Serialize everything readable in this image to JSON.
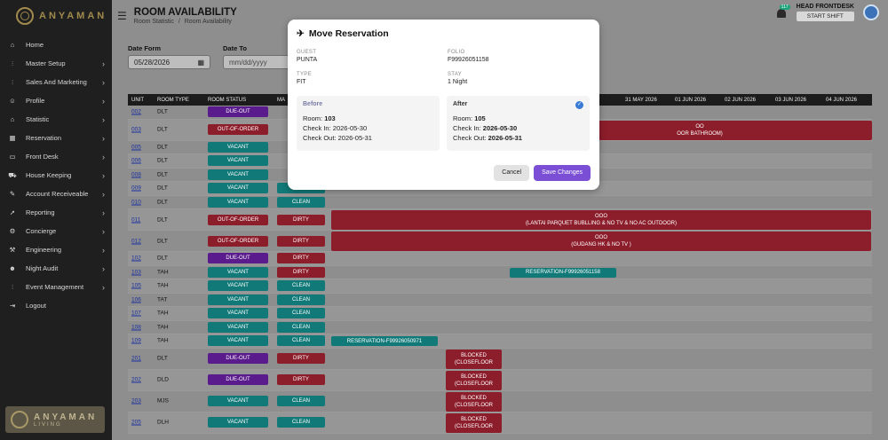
{
  "brand": {
    "name": "ANYAMAN",
    "badge_name": "ANYAMAN",
    "badge_sub": "LIVING"
  },
  "sidebar": {
    "items": [
      {
        "label": "Home",
        "icon": "home-icon",
        "chevron": false
      },
      {
        "label": "Master Setup",
        "icon": "sliders-icon",
        "chevron": true
      },
      {
        "label": "Sales And Marketing",
        "icon": "sliders-icon",
        "chevron": true
      },
      {
        "label": "Profile",
        "icon": "profile-icon",
        "chevron": true
      },
      {
        "label": "Statistic",
        "icon": "house-icon",
        "chevron": true
      },
      {
        "label": "Reservation",
        "icon": "calendar-icon",
        "chevron": true
      },
      {
        "label": "Front Desk",
        "icon": "monitor-icon",
        "chevron": true
      },
      {
        "label": "House Keeping",
        "icon": "cart-icon",
        "chevron": true
      },
      {
        "label": "Account Receiveable",
        "icon": "tag-icon",
        "chevron": true
      },
      {
        "label": "Reporting",
        "icon": "rocket-icon",
        "chevron": true
      },
      {
        "label": "Concierge",
        "icon": "gear-icon",
        "chevron": true
      },
      {
        "label": "Engineering",
        "icon": "wrench-icon",
        "chevron": true
      },
      {
        "label": "Night Audit",
        "icon": "users-icon",
        "chevron": true
      },
      {
        "label": "Event Management",
        "icon": "sliders-icon",
        "chevron": true
      },
      {
        "label": "Logout",
        "icon": "logout-icon",
        "chevron": false
      }
    ]
  },
  "header": {
    "title": "ROOM AVAILABILITY",
    "breadcrumb": [
      "Room Statistic",
      "/",
      "Room Availability"
    ],
    "notif_count": "117",
    "user_name": "HEAD FRONTDESK",
    "shift_label": "START SHIFT"
  },
  "filters": {
    "date_from_label": "Date Form",
    "date_from_value": "05/28/2026",
    "date_to_label": "Date To",
    "date_to_placeholder": "mm/dd/yyyy"
  },
  "grid": {
    "headers": [
      "UNIT",
      "ROOM TYPE",
      "ROOM STATUS",
      "MA",
      "31 MAY 2026",
      "01 JUN 2026",
      "02 JUN 2026",
      "03 JUN 2026",
      "04 JUN 2026"
    ],
    "rows": [
      {
        "unit": "002",
        "type": "DLT",
        "status": "DUE-OUT",
        "maid": ""
      },
      {
        "unit": "003",
        "type": "DLT",
        "status": "OUT-OF-ORDER",
        "maid": ""
      },
      {
        "unit": "005",
        "type": "DLT",
        "status": "VACANT",
        "maid": ""
      },
      {
        "unit": "006",
        "type": "DLT",
        "status": "VACANT",
        "maid": ""
      },
      {
        "unit": "008",
        "type": "DLT",
        "status": "VACANT",
        "maid": ""
      },
      {
        "unit": "009",
        "type": "DLT",
        "status": "VACANT",
        "maid": "CLEAN"
      },
      {
        "unit": "010",
        "type": "DLT",
        "status": "VACANT",
        "maid": "CLEAN"
      },
      {
        "unit": "011",
        "type": "DLT",
        "status": "OUT-OF-ORDER",
        "maid": "DIRTY"
      },
      {
        "unit": "012",
        "type": "DLT",
        "status": "OUT-OF-ORDER",
        "maid": "DIRTY"
      },
      {
        "unit": "102",
        "type": "DLT",
        "status": "DUE-OUT",
        "maid": "DIRTY"
      },
      {
        "unit": "103",
        "type": "TAH",
        "status": "VACANT",
        "maid": "DIRTY"
      },
      {
        "unit": "105",
        "type": "TAH",
        "status": "VACANT",
        "maid": "CLEAN"
      },
      {
        "unit": "106",
        "type": "TAT",
        "status": "VACANT",
        "maid": "CLEAN"
      },
      {
        "unit": "107",
        "type": "TAH",
        "status": "VACANT",
        "maid": "CLEAN"
      },
      {
        "unit": "108",
        "type": "TAH",
        "status": "VACANT",
        "maid": "CLEAN"
      },
      {
        "unit": "109",
        "type": "TAH",
        "status": "VACANT",
        "maid": "CLEAN"
      },
      {
        "unit": "201",
        "type": "DLT",
        "status": "DUE-OUT",
        "maid": "DIRTY"
      },
      {
        "unit": "202",
        "type": "DLD",
        "status": "DUE-OUT",
        "maid": "DIRTY"
      },
      {
        "unit": "203",
        "type": "MJS",
        "status": "VACANT",
        "maid": "CLEAN"
      },
      {
        "unit": "205",
        "type": "DLH",
        "status": "VACANT",
        "maid": "CLEAN"
      }
    ],
    "bars": {
      "r003": [
        "OO",
        "OOR BATHROOM)"
      ],
      "r011": [
        "OOO",
        "(LANTAI PARQUET BUBLLING & NO TV & NO AC OUTDOOR)"
      ],
      "r012": [
        "OOO",
        "(GUDANG HK & NO TV )"
      ],
      "r103": [
        "RESERVATION-F99926051158"
      ],
      "r109": [
        "RESERVATION-F99926050971"
      ],
      "blocked": [
        "BLOCKED",
        "(CLOSEFLOOR"
      ]
    }
  },
  "modal": {
    "title": "Move Reservation",
    "guest_label": "GUEST",
    "guest": "PUNTA",
    "folio_label": "FOLIO",
    "folio": "F99926051158",
    "type_label": "TYPE",
    "type": "FIT",
    "stay_label": "STAY",
    "stay": "1 Night",
    "before": {
      "title": "Before",
      "room_label": "Room:",
      "room": "103",
      "checkin_label": "Check In:",
      "checkin": "2026-05-30",
      "checkout_label": "Check Out:",
      "checkout": "2026-05-31"
    },
    "after": {
      "title": "After",
      "room_label": "Room:",
      "room": "105",
      "checkin_label": "Check In:",
      "checkin": "2026-05-30",
      "checkout_label": "Check Out:",
      "checkout": "2026-05-31"
    },
    "cancel_label": "Cancel",
    "save_label": "Save Changes"
  }
}
